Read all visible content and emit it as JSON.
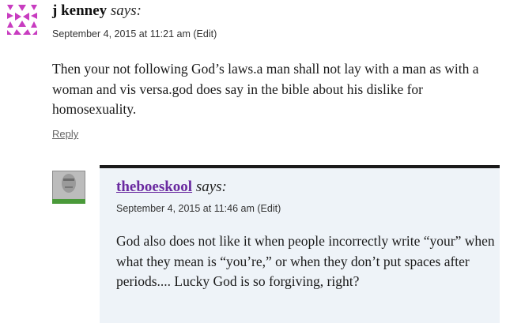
{
  "comments": [
    {
      "author": "j kenney",
      "says": "says:",
      "date": "September 4, 2015 at 11:21 am",
      "edit": "(Edit)",
      "text": "Then your not following God’s laws.a man shall not lay with a man as with a woman and vis versa.god does say in the bible about his dislike for homosexuality.",
      "reply": "Reply",
      "avatar_icon": "identicon-pink-triangles"
    },
    {
      "author": "theboeskool",
      "says": "says:",
      "date": "September 4, 2015 at 11:46 am",
      "edit": "(Edit)",
      "text": "God also does not like it when people incorrectly write “your” when what they mean is “you’re,” or when they don’t put spaces after periods.... Lucky God is so forgiving, right?",
      "avatar_icon": "user-photo-avatar"
    }
  ],
  "colors": {
    "author_link": "#6a2aa0",
    "reply_bg": "#eef3f8",
    "identicon": "#c83cc0"
  }
}
